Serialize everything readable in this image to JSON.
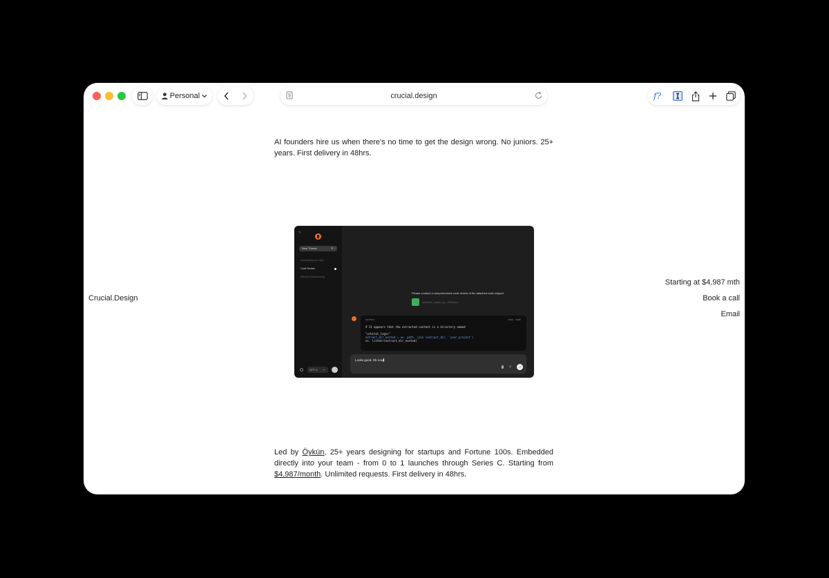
{
  "browser": {
    "profile_label": "Personal",
    "url": "crucial.design"
  },
  "page": {
    "intro": "AI founders hire us when there's no time to get the design wrong. No juniors. 25+ years. First delivery in 48hrs.",
    "brand": "Crucial.Design",
    "side_links": [
      "Starting at $4,987 mth",
      "Book a call",
      "Email"
    ],
    "led": {
      "prefix": "Led by ",
      "name_link": "Öykün",
      "middle": ", 25+ years designing for startups and Fortune 100s. Embedded directly into your team - from 0 to 1 launches through Series C. Starting from ",
      "price_link": "$4,987/month",
      "suffix": ". Unlimited requests. First delivery in 48hrs."
    }
  },
  "mock_app": {
    "new_thread": "New Thread",
    "new_thread_kbd": "⌘ I",
    "threads": [
      "Automating your daily ...",
      "Code Review",
      "Efficient Brainstorming"
    ],
    "model": "GPT-4",
    "user_message": "Please conduct a comprehensive code review of the attached code snippet.",
    "file_name": "orbital_logic.py (Python)",
    "code_lang": "python",
    "copy_label": "Copy code",
    "code_lines": [
      "# It appears that the extracted content is a directory named",
      "",
      "\"orbital_logic\"",
      "extract_dir_nested = os. path. join (extract_dir, 'your_project')",
      "os. listdir(extract_dir_nested)"
    ],
    "input_text": "Looks good. Ok now"
  }
}
